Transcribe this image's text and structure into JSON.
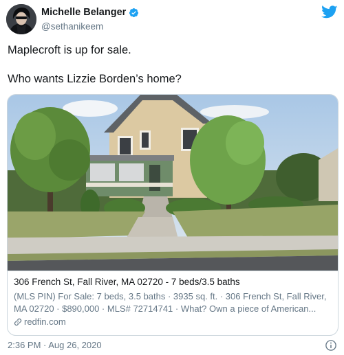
{
  "author": {
    "name": "Michelle Belanger",
    "handle": "@sethanikeem",
    "verified_icon": "verified-badge-icon",
    "avatar": "avatar"
  },
  "brand": {
    "icon": "twitter-bird-icon",
    "color": "#1da1f2"
  },
  "tweet": {
    "line1": "Maplecroft is up for sale.",
    "line2": "Who wants Lizzie Borden’s home?"
  },
  "card": {
    "image": "house-photo",
    "title": "306 French St, Fall River, MA 02720 - 7 beds/3.5 baths",
    "desc_lines": [
      "(MLS PIN) For Sale: 7 beds, 3.5 baths · 3935 sq. ft. · 306 French St, Fall River,",
      "MA 02720 · $890,000 · MLS# 72714741 · What? Own a piece of American..."
    ],
    "domain": "redfin.com",
    "domain_icon": "link-icon"
  },
  "footer": {
    "timestamp": "2:36 PM · Aug 26, 2020",
    "info_icon": "info-icon"
  },
  "colors": {
    "text": "#14171a",
    "secondary": "#657786",
    "border": "#ccd6dd",
    "verified": "#1da1f2"
  }
}
